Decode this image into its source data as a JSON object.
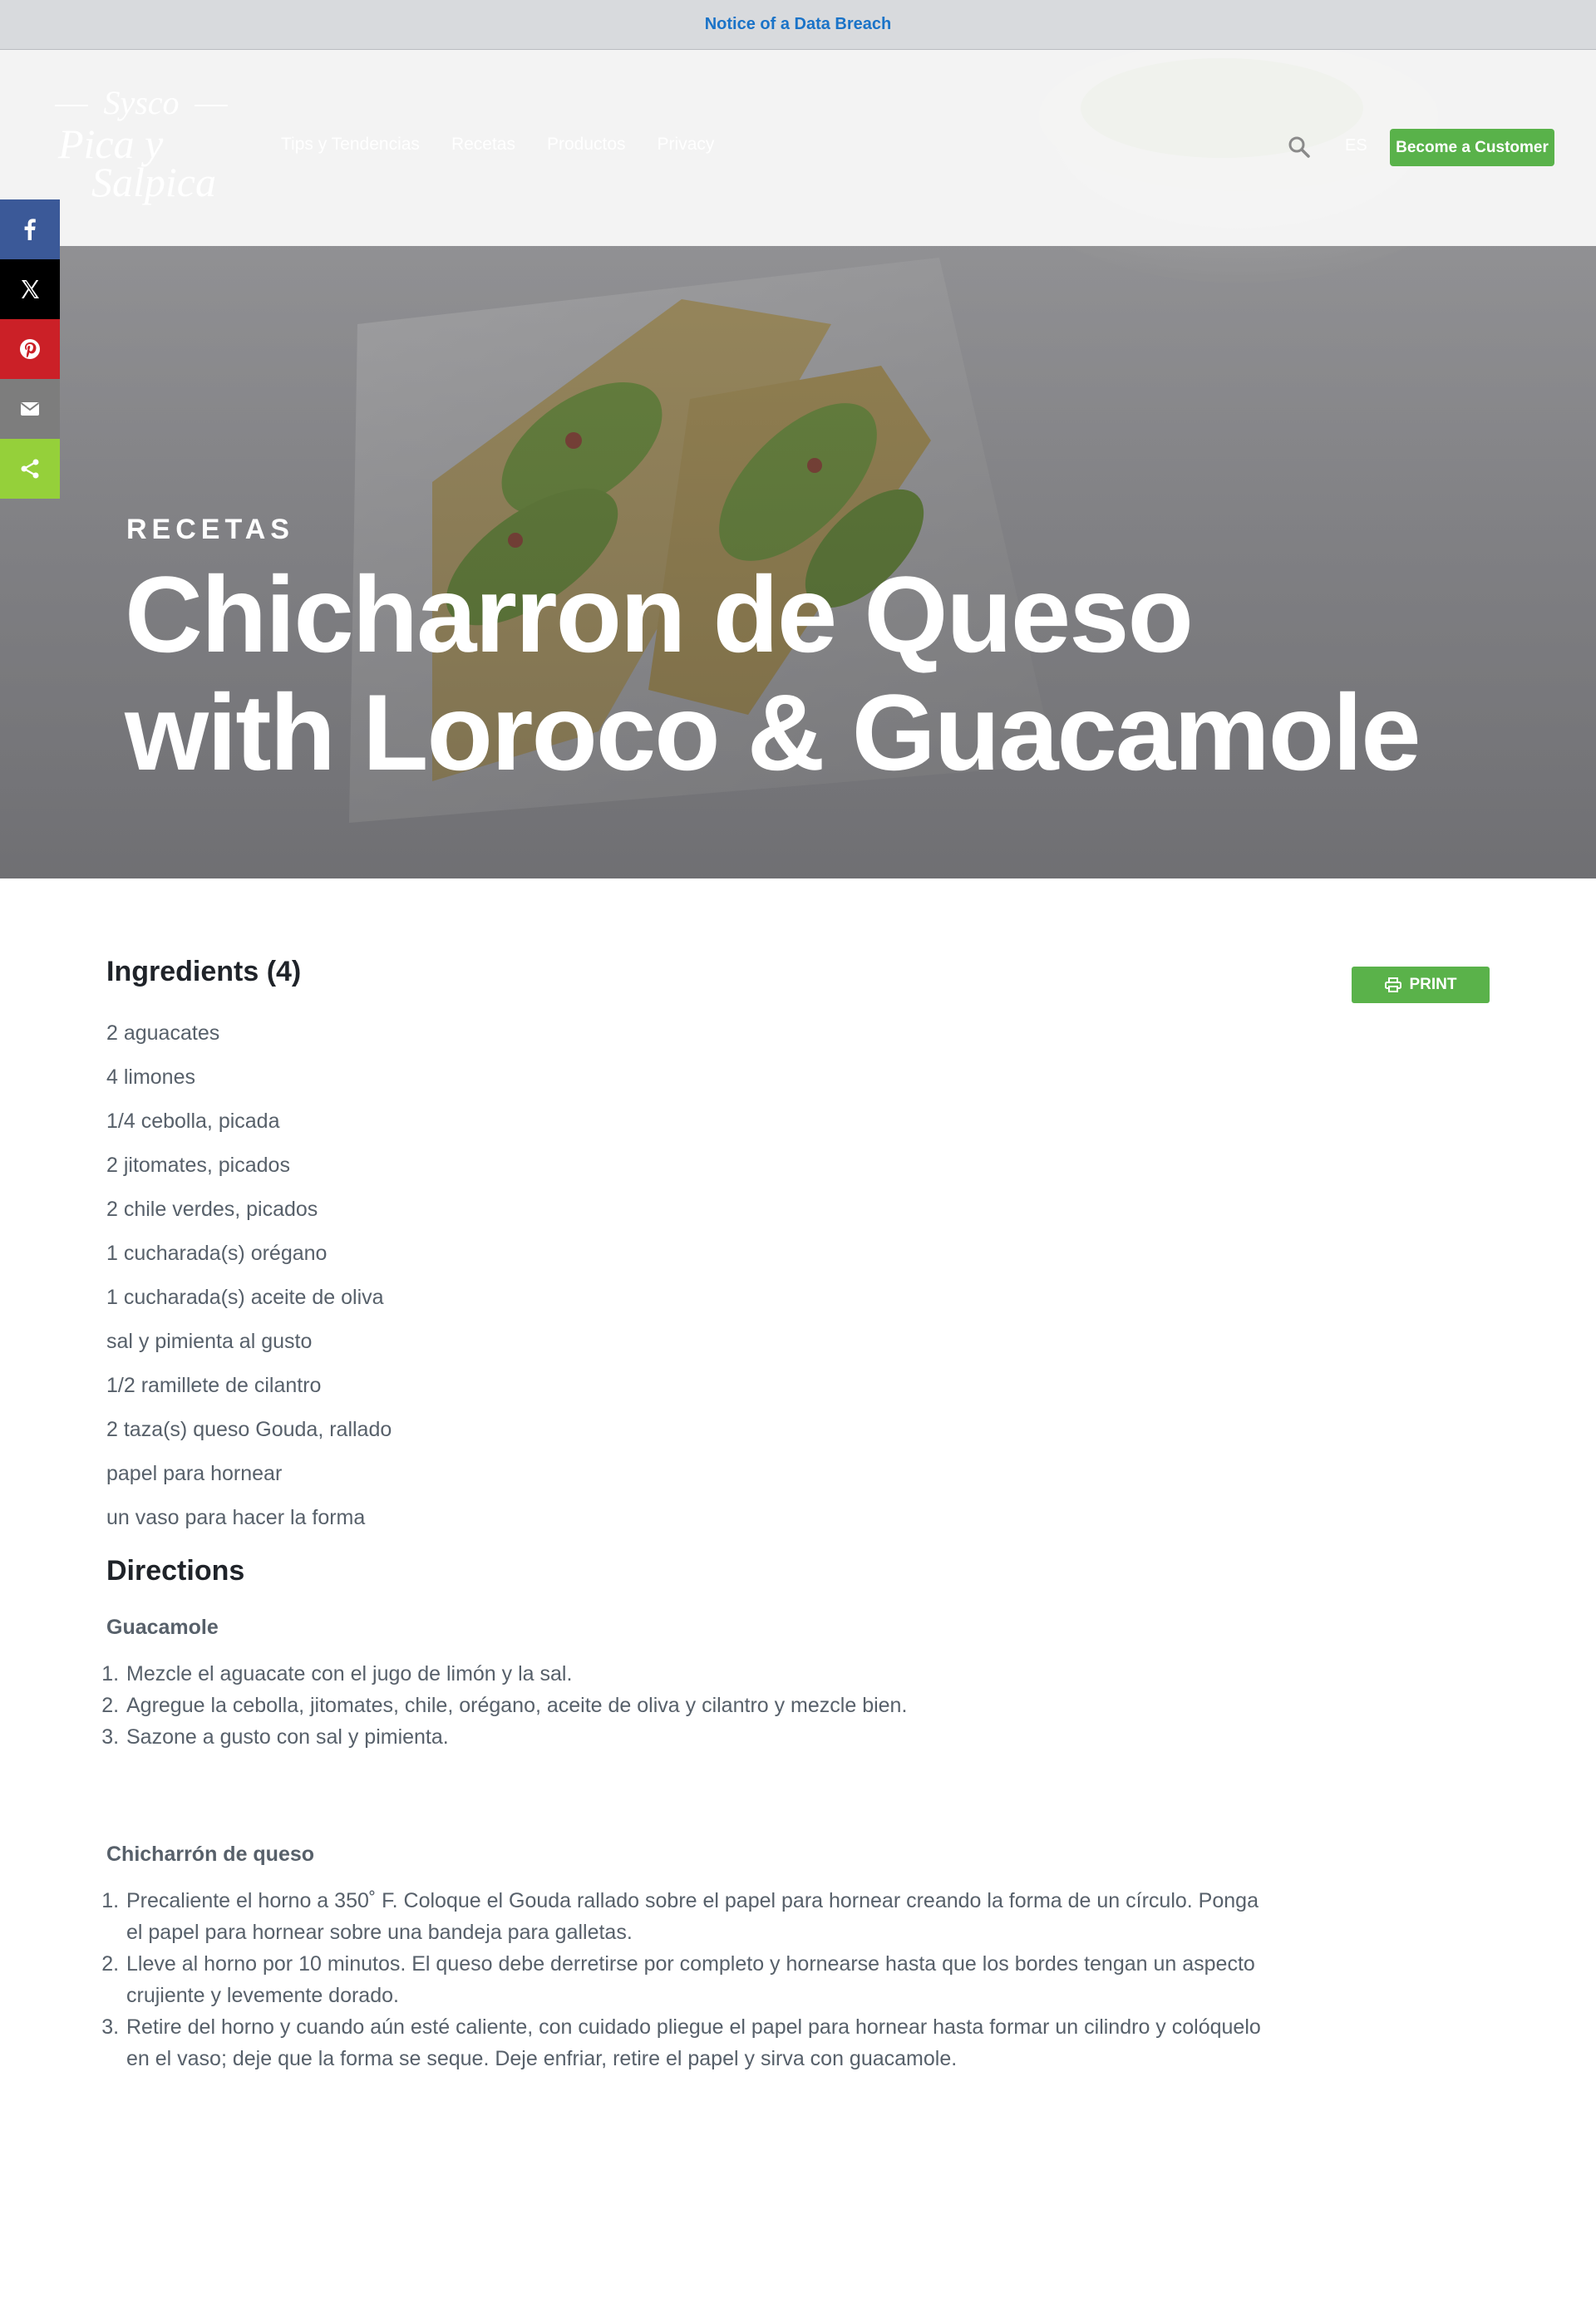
{
  "notice": {
    "label": "Notice of a Data Breach"
  },
  "header": {
    "logo": {
      "top": "Sysco",
      "script_line1": "Pica y",
      "script_line2": "Salpica"
    },
    "nav": [
      "Tips y Tendencias",
      "Recetas",
      "Productos",
      "Privacy"
    ],
    "search_icon": "search-icon",
    "language": "ES",
    "cta_label": "Become a Customer"
  },
  "share": [
    {
      "icon": "facebook-icon",
      "color": "#3b5998"
    },
    {
      "icon": "x-icon",
      "color": "#000000"
    },
    {
      "icon": "pinterest-icon",
      "color": "#cb2027"
    },
    {
      "icon": "email-icon",
      "color": "#7d7d7d"
    },
    {
      "icon": "share-icon",
      "color": "#95d03a"
    }
  ],
  "hero": {
    "kicker": "RECETAS",
    "title_line1": "Chicharron de Queso",
    "title_line2": "with Loroco & Guacamole"
  },
  "ingredients": {
    "title": "Ingredients (4)",
    "print_label": "PRINT",
    "print_icon": "printer-icon",
    "items": [
      "2 aguacates",
      "4 limones",
      "1/4 cebolla, picada",
      "2 jitomates, picados",
      "2 chile verdes, picados",
      "1 cucharada(s) orégano",
      "1 cucharada(s) aceite de oliva",
      "sal y pimienta al gusto",
      "1/2 ramillete de cilantro",
      "2 taza(s) queso Gouda, rallado",
      "papel para hornear",
      "un vaso para hacer la forma"
    ]
  },
  "directions": {
    "title": "Directions",
    "sections": [
      {
        "title": "Guacamole",
        "steps": [
          "Mezcle el aguacate con el jugo de limón y la sal.",
          "Agregue la cebolla, jitomates, chile, orégano, aceite de oliva y cilantro y mezcle bien.",
          "Sazone a gusto con sal y pimienta."
        ]
      },
      {
        "title": "Chicharrón de queso",
        "steps": [
          "Precaliente el horno a 350˚ F. Coloque el Gouda rallado sobre el papel para hornear creando la forma de un círculo. Ponga el papel para hornear sobre una bandeja para galletas.",
          "Lleve al horno por 10 minutos. El queso debe derretirse por completo y hornearse hasta que los bordes tengan un aspecto crujiente y levemente dorado.",
          "Retire del horno y cuando aún esté caliente, con cuidado pliegue el papel para hornear hasta formar un cilindro y colóquelo en el vaso; deje que la forma se seque. Deje enfriar, retire el papel y sirva con guacamole."
        ]
      }
    ]
  }
}
